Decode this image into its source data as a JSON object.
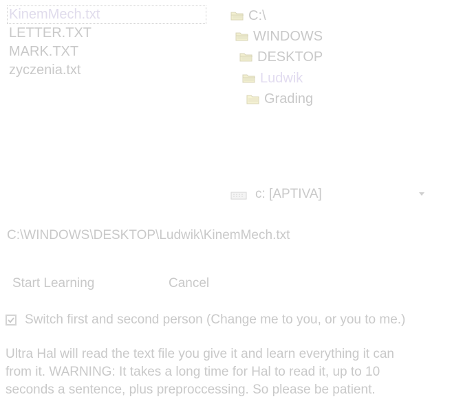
{
  "file_list": {
    "items": [
      {
        "label": "KinemMech.txt",
        "selected": true
      },
      {
        "label": "LETTER.TXT",
        "selected": false
      },
      {
        "label": "MARK.TXT",
        "selected": false
      },
      {
        "label": "zyczenia.txt",
        "selected": false
      }
    ]
  },
  "folder_tree": {
    "items": [
      {
        "label": "C:\\",
        "icon": "open-folder-icon",
        "selected": false
      },
      {
        "label": "WINDOWS",
        "icon": "open-folder-icon",
        "selected": false
      },
      {
        "label": "DESKTOP",
        "icon": "open-folder-icon",
        "selected": false
      },
      {
        "label": "Ludwik",
        "icon": "open-folder-icon",
        "selected": true
      },
      {
        "label": "Grading",
        "icon": "folder-icon",
        "selected": false
      }
    ]
  },
  "drive": {
    "selected": "c: [APTIVA]",
    "icon": "drive-icon"
  },
  "path": "C:\\WINDOWS\\DESKTOP\\Ludwik\\KinemMech.txt",
  "buttons": {
    "start_learning": "Start Learning",
    "cancel": "Cancel"
  },
  "checkbox": {
    "label": "Switch first and second person (Change me to you, or you to me.)",
    "checked": true
  },
  "description": "Ultra Hal will read the text file you give it and learn everything it can\nfrom it.  WARNING:  It takes a long time for Hal to read it, up to 10\nseconds a sentence, plus preproccessing.  So please be patient.",
  "colors": {
    "text": "#c9c9c9",
    "selected_text": "#e0dcec",
    "background": "#ffffff"
  }
}
